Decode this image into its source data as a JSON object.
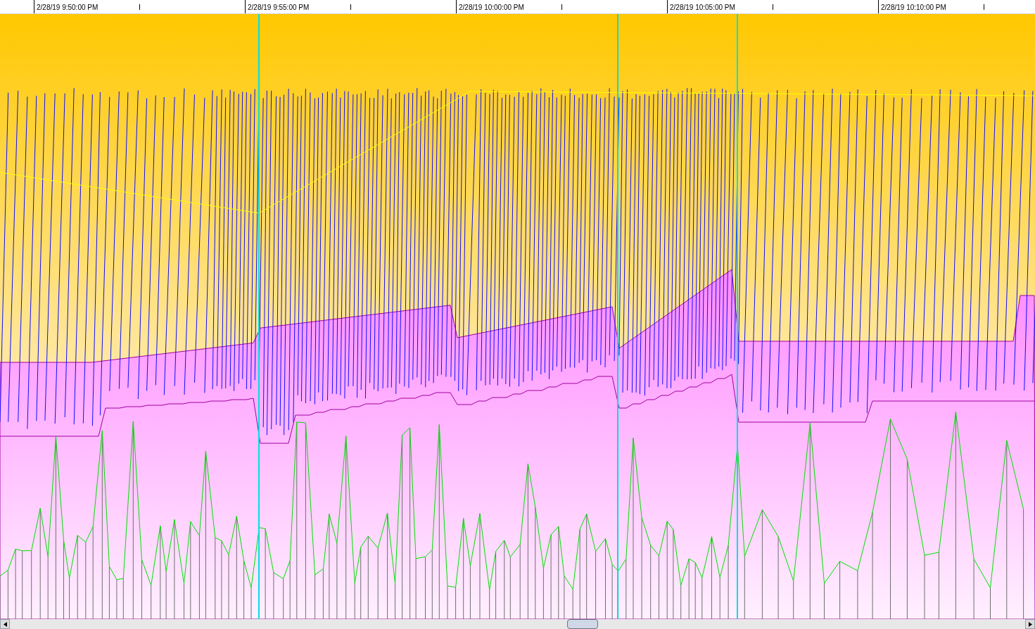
{
  "time_axis": {
    "labels": [
      "2/28/19 9:50:00 PM",
      "2/28/19 9:55:00 PM",
      "2/28/19 10:00:00 PM",
      "2/28/19 10:05:00 PM",
      "2/28/19 10:10:00 PM"
    ]
  }
}
